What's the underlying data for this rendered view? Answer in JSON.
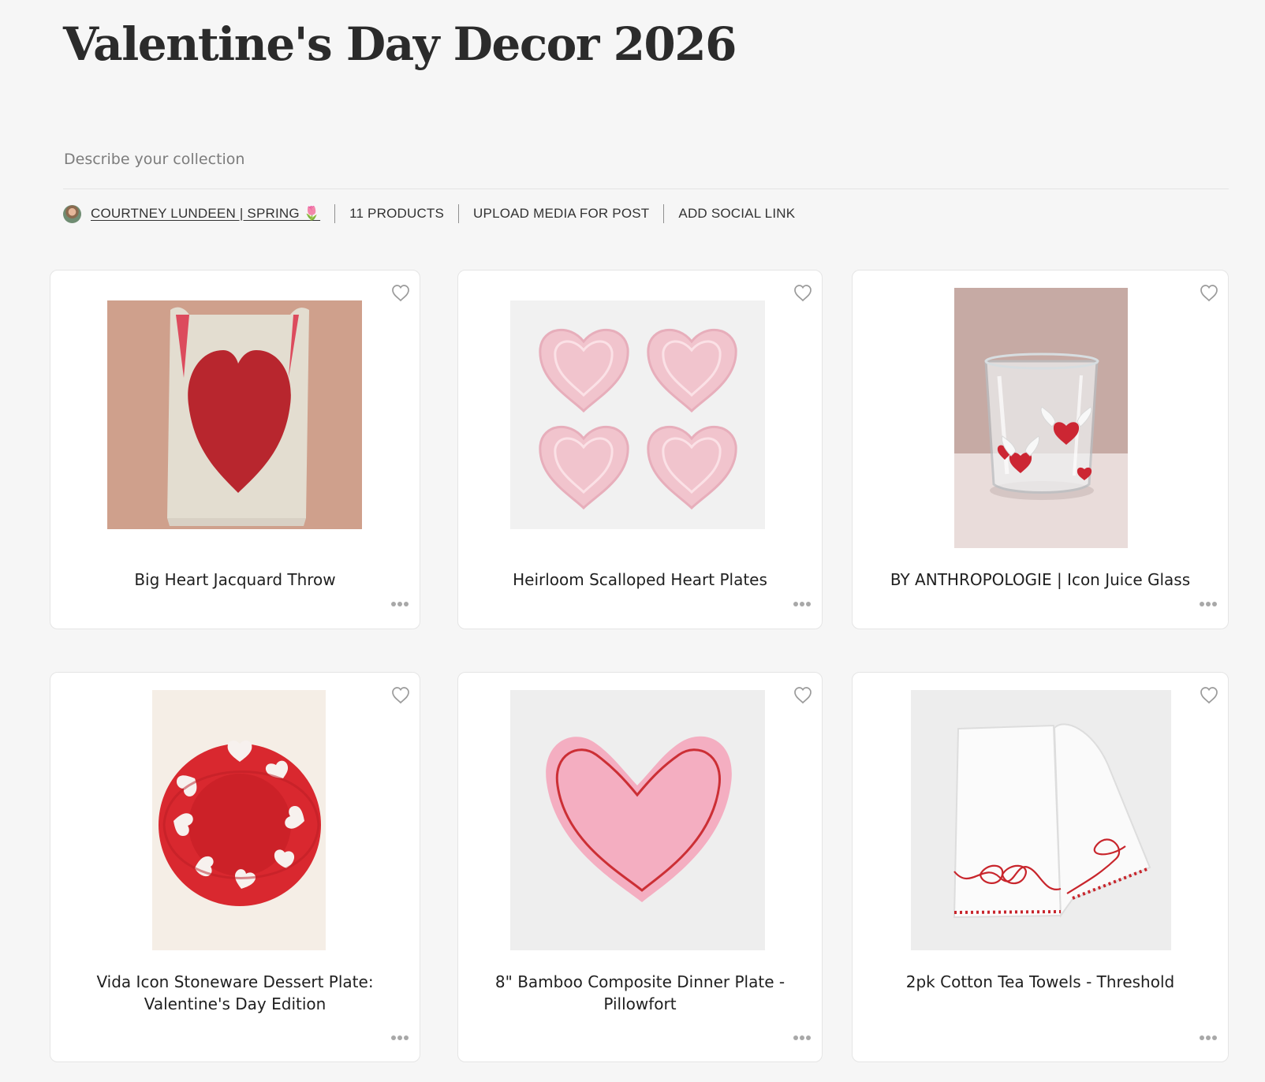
{
  "collection": {
    "title": "Valentine's Day Decor 2026",
    "description_placeholder": "Describe your collection",
    "author": "COURTNEY LUNDEEN | SPRING 🌷",
    "product_count": "11 PRODUCTS",
    "upload_media": "UPLOAD MEDIA FOR POST",
    "add_social_link": "ADD SOCIAL LINK"
  },
  "products": [
    {
      "name": "Big Heart Jacquard Throw",
      "image_subject": "heart-throw"
    },
    {
      "name": "Heirloom Scalloped Heart Plates",
      "image_subject": "scalloped-heart-plates"
    },
    {
      "name": "BY ANTHROPOLOGIE | Icon Juice Glass",
      "image_subject": "juice-glass"
    },
    {
      "name": "Vida Icon Stoneware Dessert Plate: Valentine's Day Edition",
      "image_subject": "dessert-plate"
    },
    {
      "name": "8\" Bamboo Composite Dinner Plate - Pillowfort",
      "image_subject": "heart-dinner-plate"
    },
    {
      "name": "2pk Cotton Tea Towels - Threshold",
      "image_subject": "tea-towels"
    }
  ],
  "icons": {
    "heart": "heart-outline-icon",
    "more": "more-horizontal-icon"
  },
  "colors": {
    "page_background": "#f6f6f6",
    "card_background": "#ffffff",
    "accent_red": "#d7262d",
    "pink": "#f4b7c6"
  }
}
